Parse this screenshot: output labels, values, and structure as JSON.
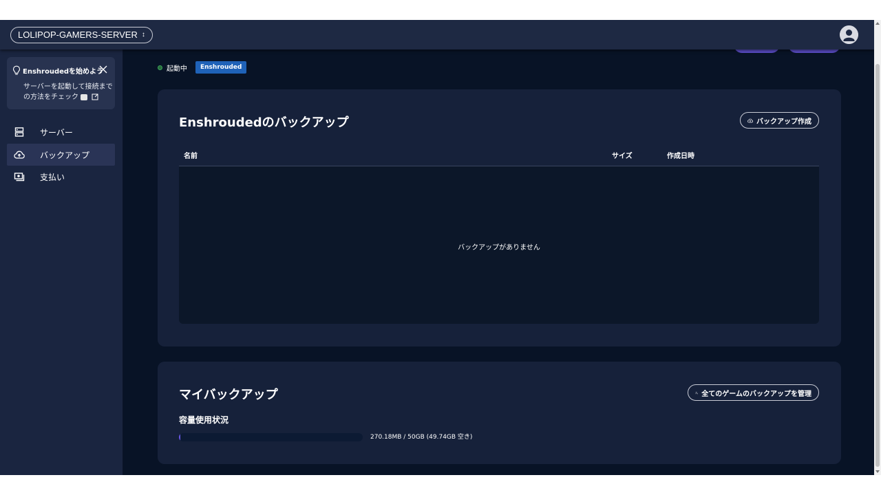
{
  "topbar": {
    "server_name": "LOLIPOP-GAMERS-SERVER",
    "server_chevron": "↕"
  },
  "sidebar": {
    "tip": {
      "title": "Enshroudedを始めよう",
      "body": "サーバーを起動して接続までの方法をチェック"
    },
    "items": [
      {
        "label": "サーバー",
        "icon": "server-icon",
        "active": false
      },
      {
        "label": "バックアップ",
        "icon": "cloud-upload-icon",
        "active": true
      },
      {
        "label": "支払い",
        "icon": "payment-icon",
        "active": false
      }
    ]
  },
  "main": {
    "status": {
      "text": "起動中",
      "game_badge": "Enshrouded",
      "dot_color": "#3aa45a",
      "badge_color": "#1f62b8"
    },
    "backup_panel": {
      "title": "Enshroudedのバックアップ",
      "create_button": "バックアップ作成",
      "columns": [
        "名前",
        "サイズ",
        "作成日時"
      ],
      "empty_message": "バックアップがありません"
    },
    "my_backup_panel": {
      "title": "マイバックアップ",
      "manage_button": "全てのゲームのバックアップを管理",
      "usage_title": "容量使用状況",
      "usage_text": "270.18MB / 50GB (49.74GB 空き)",
      "usage_fraction": 0.0054
    }
  },
  "colors": {
    "background": "#081326",
    "panel": "#16213a",
    "sidebar": "#1a2540",
    "accent": "#5b4ec9"
  }
}
